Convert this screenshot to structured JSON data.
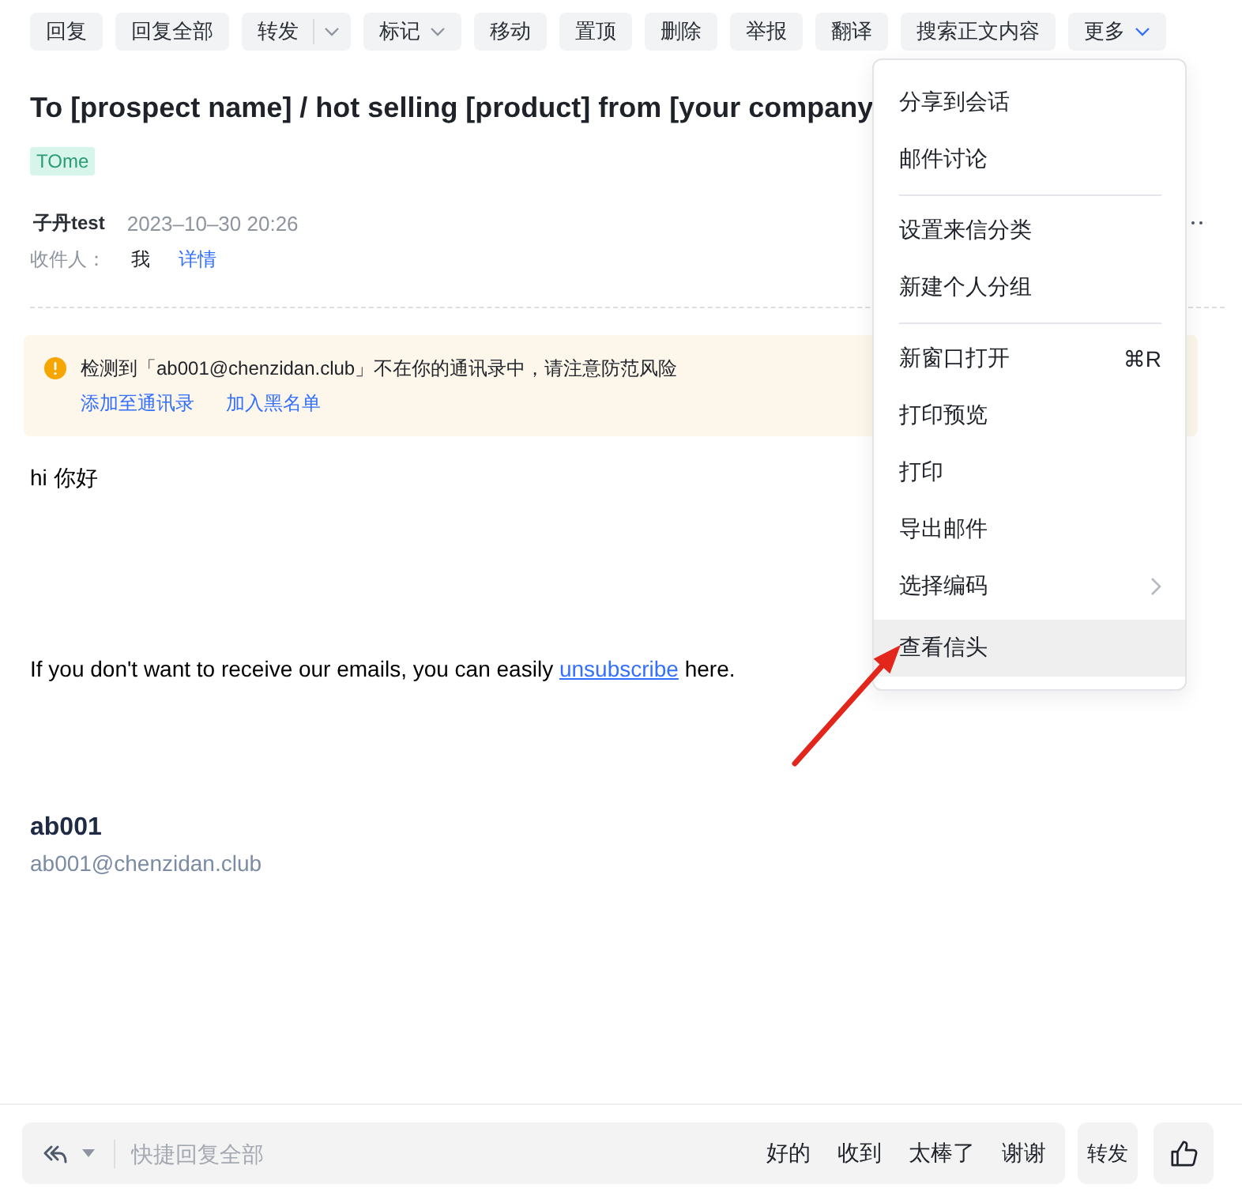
{
  "toolbar": {
    "buttons": [
      {
        "label": "回复",
        "kind": "plain",
        "expanded": false
      },
      {
        "label": "回复全部",
        "kind": "plain",
        "expanded": false
      },
      {
        "label": "转发",
        "kind": "split",
        "expanded": false
      },
      {
        "label": "标记",
        "kind": "dropdown",
        "expanded": false
      },
      {
        "label": "移动",
        "kind": "plain",
        "expanded": false
      },
      {
        "label": "置顶",
        "kind": "plain",
        "expanded": false
      },
      {
        "label": "删除",
        "kind": "plain",
        "expanded": false
      },
      {
        "label": "举报",
        "kind": "plain",
        "expanded": false
      },
      {
        "label": "翻译",
        "kind": "plain",
        "expanded": false
      },
      {
        "label": "搜索正文内容",
        "kind": "plain",
        "expanded": false
      },
      {
        "label": "更多",
        "kind": "dropdown",
        "expanded": true
      }
    ]
  },
  "menu": {
    "groups": [
      [
        {
          "label": "分享到会话",
          "kind": "action",
          "selected": false
        },
        {
          "label": "邮件讨论",
          "kind": "action",
          "selected": false
        }
      ],
      [
        {
          "label": "设置来信分类",
          "kind": "action",
          "selected": false
        },
        {
          "label": "新建个人分组",
          "kind": "action",
          "selected": false
        }
      ],
      [
        {
          "label": "新窗口打开",
          "kind": "action",
          "shortcut": "⌘R",
          "selected": false
        },
        {
          "label": "打印预览",
          "kind": "action",
          "selected": false
        },
        {
          "label": "打印",
          "kind": "action",
          "selected": false
        },
        {
          "label": "导出邮件",
          "kind": "action",
          "selected": false
        },
        {
          "label": "选择编码",
          "kind": "submenu",
          "selected": false
        },
        {
          "label": "查看信头",
          "kind": "action",
          "selected": true
        }
      ]
    ]
  },
  "message": {
    "title": "To [prospect name] / hot selling [product] from [your company",
    "tags": [
      "TOme"
    ],
    "sender": {
      "name": "子丹test",
      "time": "2023–10–30 20:26"
    },
    "recipients": {
      "label": "收件人：",
      "names": [
        "我"
      ],
      "details_link": "详情"
    },
    "warning": {
      "text": "检测到「ab001@chenzidan.club」不在你的通讯录中，请注意防范风险",
      "actions": [
        "添加至通讯录",
        "加入黑名单"
      ]
    },
    "body": [
      {
        "kind": "text",
        "text": "hi 你好"
      },
      {
        "kind": "link_sentence",
        "before": "If you don't want to receive our emails, you can easily ",
        "link": "unsubscribe",
        "after": " here."
      }
    ],
    "signature": {
      "name": "ab001",
      "email": "ab001@chenzidan.club"
    }
  },
  "reply_bar": {
    "placeholder": "快捷回复全部",
    "quick_replies": [
      "好的",
      "收到",
      "太棒了",
      "谢谢"
    ],
    "forward_button": "转发"
  }
}
